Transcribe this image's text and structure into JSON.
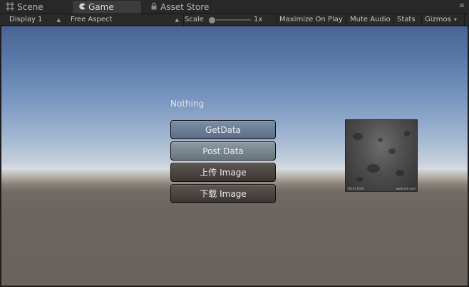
{
  "tabs": [
    {
      "label": "Scene",
      "icon": "grid-icon",
      "active": false
    },
    {
      "label": "Game",
      "icon": "pacman-icon",
      "active": true
    },
    {
      "label": "Asset Store",
      "icon": "lock-icon",
      "active": false
    }
  ],
  "toolbar": {
    "display": "Display 1",
    "aspect": "Free Aspect",
    "scale_label": "Scale",
    "scale_value": "1x",
    "maximize": "Maximize On Play",
    "mute": "Mute Audio",
    "stats": "Stats",
    "gizmos": "Gizmos"
  },
  "game": {
    "status_text": "Nothing",
    "buttons": [
      "GetData",
      "Post Data",
      "上传 Image",
      "下载 Image"
    ],
    "texture_caption_left": "1024×1024",
    "texture_caption_right": "www.site.com"
  },
  "colors": {
    "sky_top": "#4a6492",
    "horizon": "#d6dbe0",
    "ground": "#6a625c",
    "button_blue": "#6b7f96"
  }
}
